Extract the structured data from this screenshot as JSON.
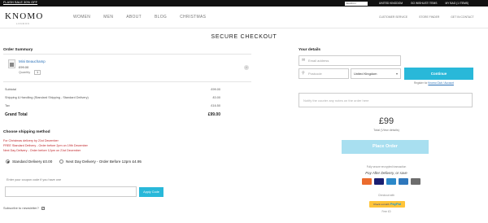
{
  "topbar": {
    "promo": "FLASH SALE 30% OFF",
    "search_placeholder": "SEARCH",
    "links": [
      "UNITED KINGDOM",
      "GO WISHLIST ITEMS",
      "MY BAG (1 ITEMS)"
    ]
  },
  "header": {
    "logo": "KNOMO",
    "logo_sub": "LONDON",
    "nav": [
      "WOMEN",
      "MEN",
      "ABOUT",
      "BLOG",
      "CHRISTMAS"
    ],
    "links": [
      "CUSTOMER SERVICE",
      "STORE FINDER",
      "GET IN CONTACT"
    ]
  },
  "page_title": "SECURE CHECKOUT",
  "order_summary": {
    "heading": "Order Summary",
    "item": {
      "name": "Mini Beauchamp",
      "price": "£99.00",
      "qty_label": "Quantity",
      "qty": "1",
      "remove_icon": "close-icon"
    },
    "rows": [
      {
        "label": "Subtotal",
        "value": "£99.00"
      },
      {
        "label": "Shipping & Handling (Standard Shipping - Standard Delivery)",
        "value": "£0.00"
      },
      {
        "label": "Tax",
        "value": "£16.50"
      }
    ],
    "grand_total": {
      "label": "Grand Total",
      "value": "£99.00"
    }
  },
  "shipping": {
    "heading": "Choose shipping method",
    "notices": [
      "For Christmas delivery by 21st December",
      "FREE Standard Delivery - Order before 2pm on 19th December",
      "Next Day Delivery - Order before 12pm on 21st December"
    ],
    "options": [
      {
        "label": "Standard Delivery £0.00",
        "selected": true
      },
      {
        "label": "Next Day Delivery - Order Before 12pm £4.95",
        "selected": false
      }
    ]
  },
  "coupon": {
    "label": "Enter your coupon code if you have one",
    "value": "",
    "button": "Apply Code"
  },
  "subscribe": {
    "label": "Subscribe to newsletter?",
    "checked": true
  },
  "details": {
    "heading": "Your details",
    "email_placeholder": "Email address",
    "postcode_placeholder": "Postcode",
    "country": "United Kingdom",
    "continue_label": "Continue",
    "register_prefix": "Register for",
    "register_link": "Knomo Club / Account"
  },
  "notes_placeholder": "Notify the courier any notes on the order here",
  "totals": {
    "amount": "£99",
    "label": "Total (View details)"
  },
  "place_order_label": "Place Order",
  "payment": {
    "secure_note": "Fully secure encrypted transaction",
    "pay_after": "Pay After Delivery, or save",
    "cards": [
      {
        "name": "mastercard",
        "color": "#eb6b2d"
      },
      {
        "name": "visa",
        "color": "#1a1f71"
      },
      {
        "name": "maestro",
        "color": "#2b88c9"
      },
      {
        "name": "amex",
        "color": "#2e77bc"
      },
      {
        "name": "card",
        "color": "#6d6d6d"
      }
    ],
    "or_label": "Checkout with",
    "paypal_label": "PayPal",
    "paypal_prefix": "Check out with",
    "paypal_note": "Free £0"
  },
  "colors": {
    "accent": "#29b8d9",
    "alert": "#c0262b",
    "link": "#2a71b8"
  }
}
